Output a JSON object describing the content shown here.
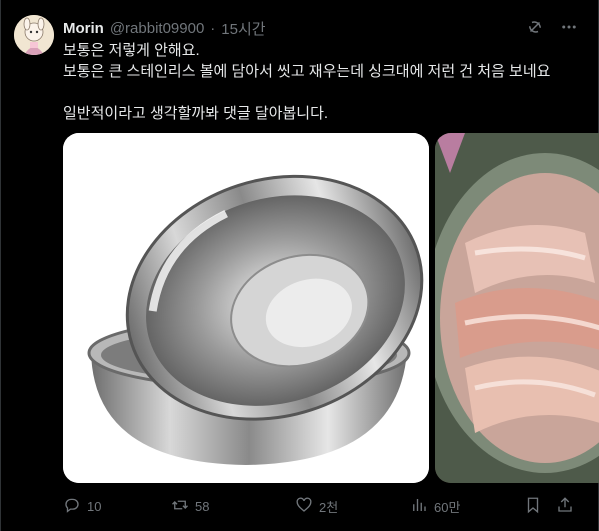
{
  "author": {
    "name": "Morin",
    "handle": "@rabbit09900",
    "separator": "·",
    "time": "15시간"
  },
  "post": {
    "line1": "보통은 저렇게 안해요.",
    "line2": "보통은 큰 스테인리스 볼에 담아서 씻고 재우는데 싱크대에 저런 건 처음 보네요",
    "line3": "일반적이라고 생각할까봐 댓글 달아봅니다."
  },
  "icons": {
    "grok": "grok-icon",
    "more": "more-icon",
    "reply": "reply-icon",
    "repost": "repost-icon",
    "like": "like-icon",
    "views": "views-icon",
    "bookmark": "bookmark-icon",
    "share": "share-icon"
  },
  "actions": {
    "replies": "10",
    "reposts": "58",
    "likes": "2천",
    "views": "60만"
  },
  "colors": {
    "background": "#000000",
    "text": "#e7e9ea",
    "muted": "#71767b",
    "border": "#2f3336"
  }
}
